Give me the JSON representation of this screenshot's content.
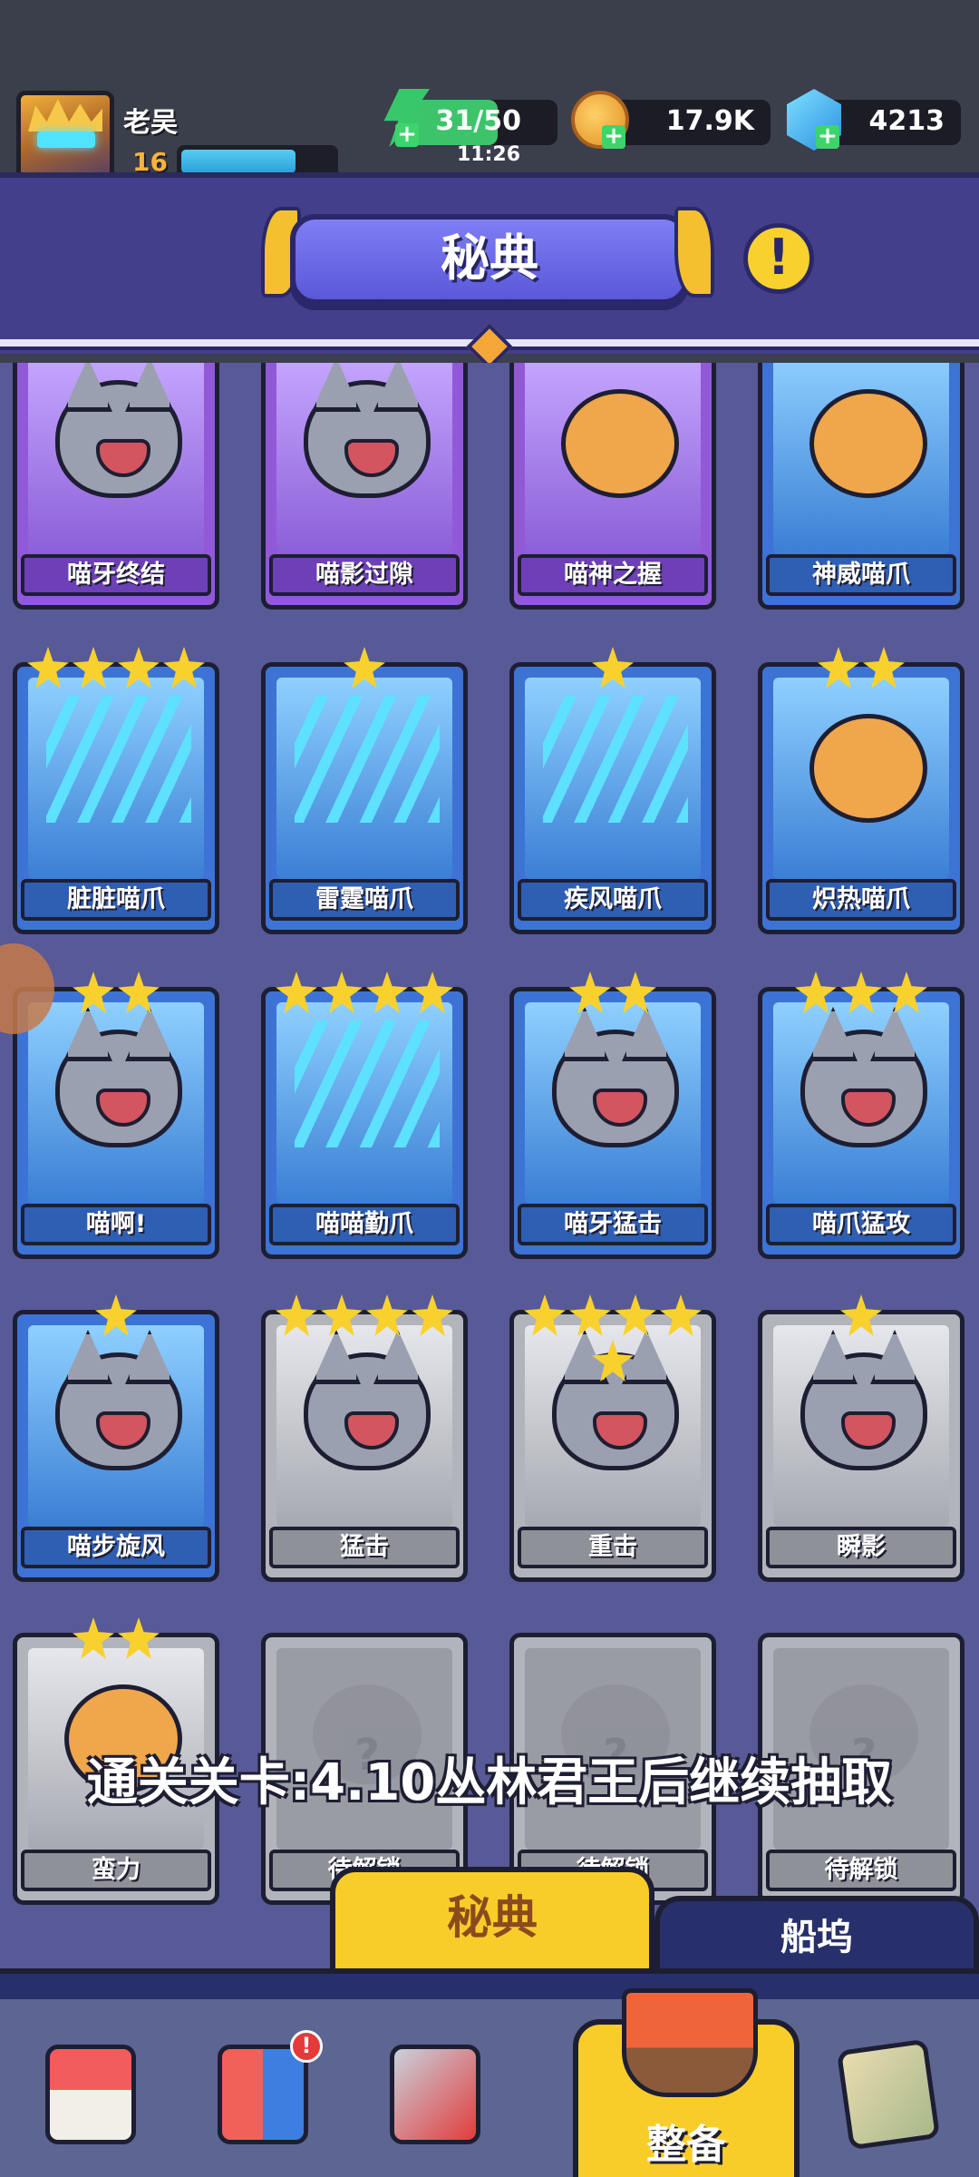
{
  "player": {
    "name": "老吴",
    "level": "16",
    "xp_fraction": 0.75
  },
  "resources": {
    "energy": "31/50",
    "energy_fraction": 0.62,
    "energy_timer": "11:26",
    "coins": "17.9K",
    "gems": "4213"
  },
  "header": {
    "title": "秘典",
    "info_icon": "exclamation-icon"
  },
  "cards": [
    {
      "name": "喵牙终结",
      "stars": 0,
      "color": "purple",
      "art": "cat"
    },
    {
      "name": "喵影过隙",
      "stars": 0,
      "color": "purple",
      "art": "cat"
    },
    {
      "name": "喵神之握",
      "stars": 0,
      "color": "purple",
      "art": "paw"
    },
    {
      "name": "神威喵爪",
      "stars": 0,
      "color": "blue",
      "art": "paw"
    },
    {
      "name": "脏脏喵爪",
      "stars": 4,
      "color": "blue",
      "art": "claw"
    },
    {
      "name": "雷霆喵爪",
      "stars": 1,
      "color": "blue",
      "art": "claw"
    },
    {
      "name": "疾风喵爪",
      "stars": 1,
      "color": "blue",
      "art": "claw"
    },
    {
      "name": "炽热喵爪",
      "stars": 2,
      "color": "blue",
      "art": "paw"
    },
    {
      "name": "喵啊!",
      "stars": 2,
      "color": "blue",
      "art": "cat"
    },
    {
      "name": "喵喵勤爪",
      "stars": 4,
      "color": "blue",
      "art": "claw"
    },
    {
      "name": "喵牙猛击",
      "stars": 2,
      "color": "blue",
      "art": "cat"
    },
    {
      "name": "喵爪猛攻",
      "stars": 3,
      "color": "blue",
      "art": "cat"
    },
    {
      "name": "喵步旋风",
      "stars": 1,
      "color": "blue",
      "art": "cat"
    },
    {
      "name": "猛击",
      "stars": 4,
      "color": "gray",
      "art": "cat"
    },
    {
      "name": "重击",
      "stars": 5,
      "color": "gray",
      "art": "cat"
    },
    {
      "name": "瞬影",
      "stars": 1,
      "color": "gray",
      "art": "cat"
    },
    {
      "name": "蛮力",
      "stars": 2,
      "color": "gray",
      "art": "paw"
    },
    {
      "name": "待解锁",
      "stars": 0,
      "color": "gray",
      "art": "locked"
    },
    {
      "name": "待解锁",
      "stars": 0,
      "color": "gray",
      "art": "locked"
    },
    {
      "name": "待解锁",
      "stars": 0,
      "color": "gray",
      "art": "locked"
    }
  ],
  "overlay_text": "通关关卡:4.10丛林君王后继续抽取",
  "tabs": {
    "codex": "秘典",
    "dock": "船坞"
  },
  "bottom_nav": {
    "team_badge": "!",
    "equip_label": "整备"
  },
  "colors": {
    "purple_card": "#9159d8",
    "blue_card": "#3c73d4",
    "gray_card": "#b2b4bb",
    "accent_yellow": "#f8cd2a",
    "header_purple": "#433f8b"
  }
}
